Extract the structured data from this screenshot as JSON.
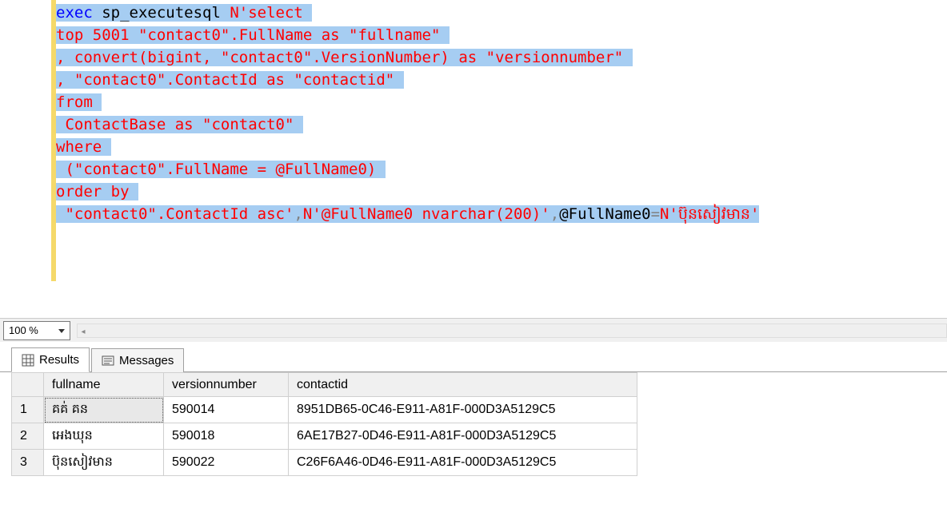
{
  "code": {
    "lines": [
      [
        {
          "cls": "kw-blue sel",
          "t": "exec"
        },
        {
          "cls": "sel",
          "t": " sp_executesql "
        },
        {
          "cls": "str-red sel",
          "t": "N'select "
        }
      ],
      [
        {
          "cls": "str-red sel",
          "t": "top 5001 \"contact0\".FullName as \"fullname\" "
        }
      ],
      [
        {
          "cls": "str-red sel",
          "t": ", convert(bigint, \"contact0\".VersionNumber) as \"versionnumber\" "
        }
      ],
      [
        {
          "cls": "str-red sel",
          "t": ", \"contact0\".ContactId as \"contactid\" "
        }
      ],
      [
        {
          "cls": "str-red sel",
          "t": "from "
        }
      ],
      [
        {
          "cls": "str-red sel",
          "t": " ContactBase as \"contact0\" "
        }
      ],
      [
        {
          "cls": "str-red sel",
          "t": "where "
        }
      ],
      [
        {
          "cls": "str-red sel",
          "t": " (\"contact0\".FullName = @FullName0) "
        }
      ],
      [
        {
          "cls": "str-red sel",
          "t": "order by "
        }
      ],
      [
        {
          "cls": "str-red sel",
          "t": " \"contact0\".ContactId asc'"
        },
        {
          "cls": "punct sel",
          "t": ","
        },
        {
          "cls": "str-red sel",
          "t": "N'@FullName0 nvarchar(200)'"
        },
        {
          "cls": "punct sel",
          "t": ","
        },
        {
          "cls": "txt-black sel",
          "t": "@FullName0"
        },
        {
          "cls": "punct sel",
          "t": "="
        },
        {
          "cls": "str-red sel",
          "t": "N'ប៊ុនសៀវមាន'"
        }
      ]
    ]
  },
  "zoom": "100 %",
  "tabs": {
    "results": "Results",
    "messages": "Messages"
  },
  "grid": {
    "columns": [
      "fullname",
      "versionnumber",
      "contactid"
    ],
    "rows": [
      {
        "n": "1",
        "fullname": "គគ់ គន",
        "versionnumber": "590014",
        "contactid": "8951DB65-0C46-E911-A81F-000D3A5129C5"
      },
      {
        "n": "2",
        "fullname": "អេងឃុន",
        "versionnumber": "590018",
        "contactid": "6AE17B27-0D46-E911-A81F-000D3A5129C5"
      },
      {
        "n": "3",
        "fullname": "ប៊ុនសៀវមាន",
        "versionnumber": "590022",
        "contactid": "C26F6A46-0D46-E911-A81F-000D3A5129C5"
      }
    ]
  }
}
